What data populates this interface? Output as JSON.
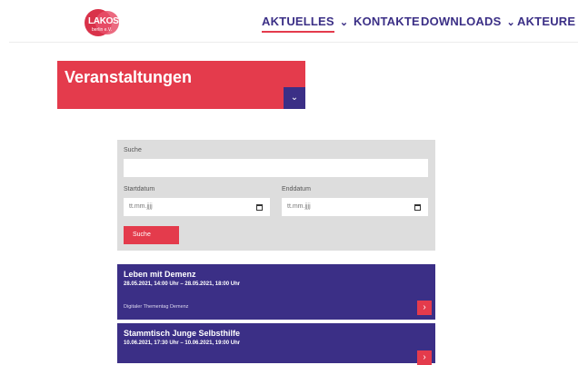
{
  "logo": {
    "text": "LAKOS",
    "sub": "berlin e.V."
  },
  "nav": [
    {
      "label": "AKTUELLES",
      "has_dropdown": true,
      "active": true
    },
    {
      "label": "KONTAKTE",
      "has_dropdown": false,
      "active": false
    },
    {
      "label": "DOWNLOADS",
      "has_dropdown": true,
      "active": false
    },
    {
      "label": "AKTEURE",
      "has_dropdown": true,
      "active": false
    }
  ],
  "page": {
    "title": "Veranstaltungen"
  },
  "search": {
    "search_label": "Suche",
    "search_value": "",
    "start_label": "Startdatum",
    "start_placeholder": "tt.mm.jjjj",
    "end_label": "Enddatum",
    "end_placeholder": "tt.mm.jjjj",
    "button_label": "Suche"
  },
  "events": [
    {
      "title": "Leben mit Demenz",
      "date": "28.05.2021, 14:00 Uhr – 28.05.2021, 18:00 Uhr",
      "category": "Digitaler Thementag Demenz"
    },
    {
      "title": "Stammtisch Junge Selbsthilfe",
      "date": "10.06.2021, 17:30 Uhr – 10.06.2021, 19:00 Uhr",
      "category": ""
    }
  ],
  "colors": {
    "accent_red": "#e43b4c",
    "brand_purple": "#3b2f86",
    "form_bg": "#dddddd"
  },
  "icons": {
    "dropdown": "chevron-down-icon",
    "date": "calendar-icon",
    "card": "chevron-right-icon"
  }
}
